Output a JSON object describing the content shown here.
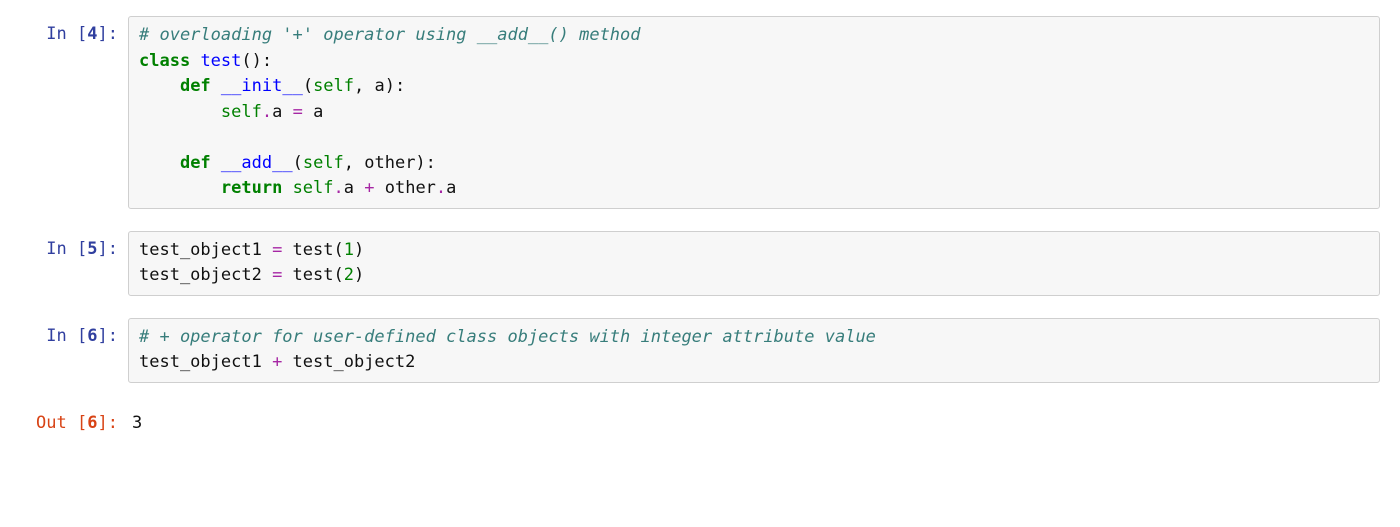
{
  "cells": [
    {
      "prompt": {
        "kind": "In",
        "num": "4"
      },
      "tokens": [
        {
          "c": "tok-comment",
          "t": "# overloading '+' operator using __add__() method"
        },
        {
          "t": "\n"
        },
        {
          "c": "tok-keyword",
          "t": "class"
        },
        {
          "t": " "
        },
        {
          "c": "tok-defname",
          "t": "test"
        },
        {
          "c": "tok-punct",
          "t": "():"
        },
        {
          "t": "\n    "
        },
        {
          "c": "tok-keyword",
          "t": "def"
        },
        {
          "t": " "
        },
        {
          "c": "tok-defname",
          "t": "__init__"
        },
        {
          "c": "tok-punct",
          "t": "("
        },
        {
          "c": "tok-builtin",
          "t": "self"
        },
        {
          "c": "tok-punct",
          "t": ", a):"
        },
        {
          "t": "\n        "
        },
        {
          "c": "tok-builtin",
          "t": "self"
        },
        {
          "c": "tok-op",
          "t": "."
        },
        {
          "c": "tok-name",
          "t": "a "
        },
        {
          "c": "tok-op",
          "t": "="
        },
        {
          "c": "tok-name",
          "t": " a"
        },
        {
          "t": "\n    \n    "
        },
        {
          "c": "tok-keyword",
          "t": "def"
        },
        {
          "t": " "
        },
        {
          "c": "tok-defname",
          "t": "__add__"
        },
        {
          "c": "tok-punct",
          "t": "("
        },
        {
          "c": "tok-builtin",
          "t": "self"
        },
        {
          "c": "tok-punct",
          "t": ", other):"
        },
        {
          "t": "\n        "
        },
        {
          "c": "tok-keyword",
          "t": "return"
        },
        {
          "t": " "
        },
        {
          "c": "tok-builtin",
          "t": "self"
        },
        {
          "c": "tok-op",
          "t": "."
        },
        {
          "c": "tok-name",
          "t": "a "
        },
        {
          "c": "tok-op",
          "t": "+"
        },
        {
          "c": "tok-name",
          "t": " other"
        },
        {
          "c": "tok-op",
          "t": "."
        },
        {
          "c": "tok-name",
          "t": "a"
        }
      ]
    },
    {
      "prompt": {
        "kind": "In",
        "num": "5"
      },
      "tokens": [
        {
          "c": "tok-name",
          "t": "test_object1 "
        },
        {
          "c": "tok-op",
          "t": "="
        },
        {
          "c": "tok-name",
          "t": " test("
        },
        {
          "c": "tok-num",
          "t": "1"
        },
        {
          "c": "tok-punct",
          "t": ")"
        },
        {
          "t": "\n"
        },
        {
          "c": "tok-name",
          "t": "test_object2 "
        },
        {
          "c": "tok-op",
          "t": "="
        },
        {
          "c": "tok-name",
          "t": " test("
        },
        {
          "c": "tok-num",
          "t": "2"
        },
        {
          "c": "tok-punct",
          "t": ")"
        }
      ]
    },
    {
      "prompt": {
        "kind": "In",
        "num": "6"
      },
      "tokens": [
        {
          "c": "tok-comment",
          "t": "# + operator for user-defined class objects with integer attribute value"
        },
        {
          "t": "\n"
        },
        {
          "c": "tok-name",
          "t": "test_object1 "
        },
        {
          "c": "tok-op",
          "t": "+"
        },
        {
          "c": "tok-name",
          "t": " test_object2"
        }
      ]
    },
    {
      "prompt": {
        "kind": "Out",
        "num": "6"
      },
      "output": "3"
    }
  ]
}
